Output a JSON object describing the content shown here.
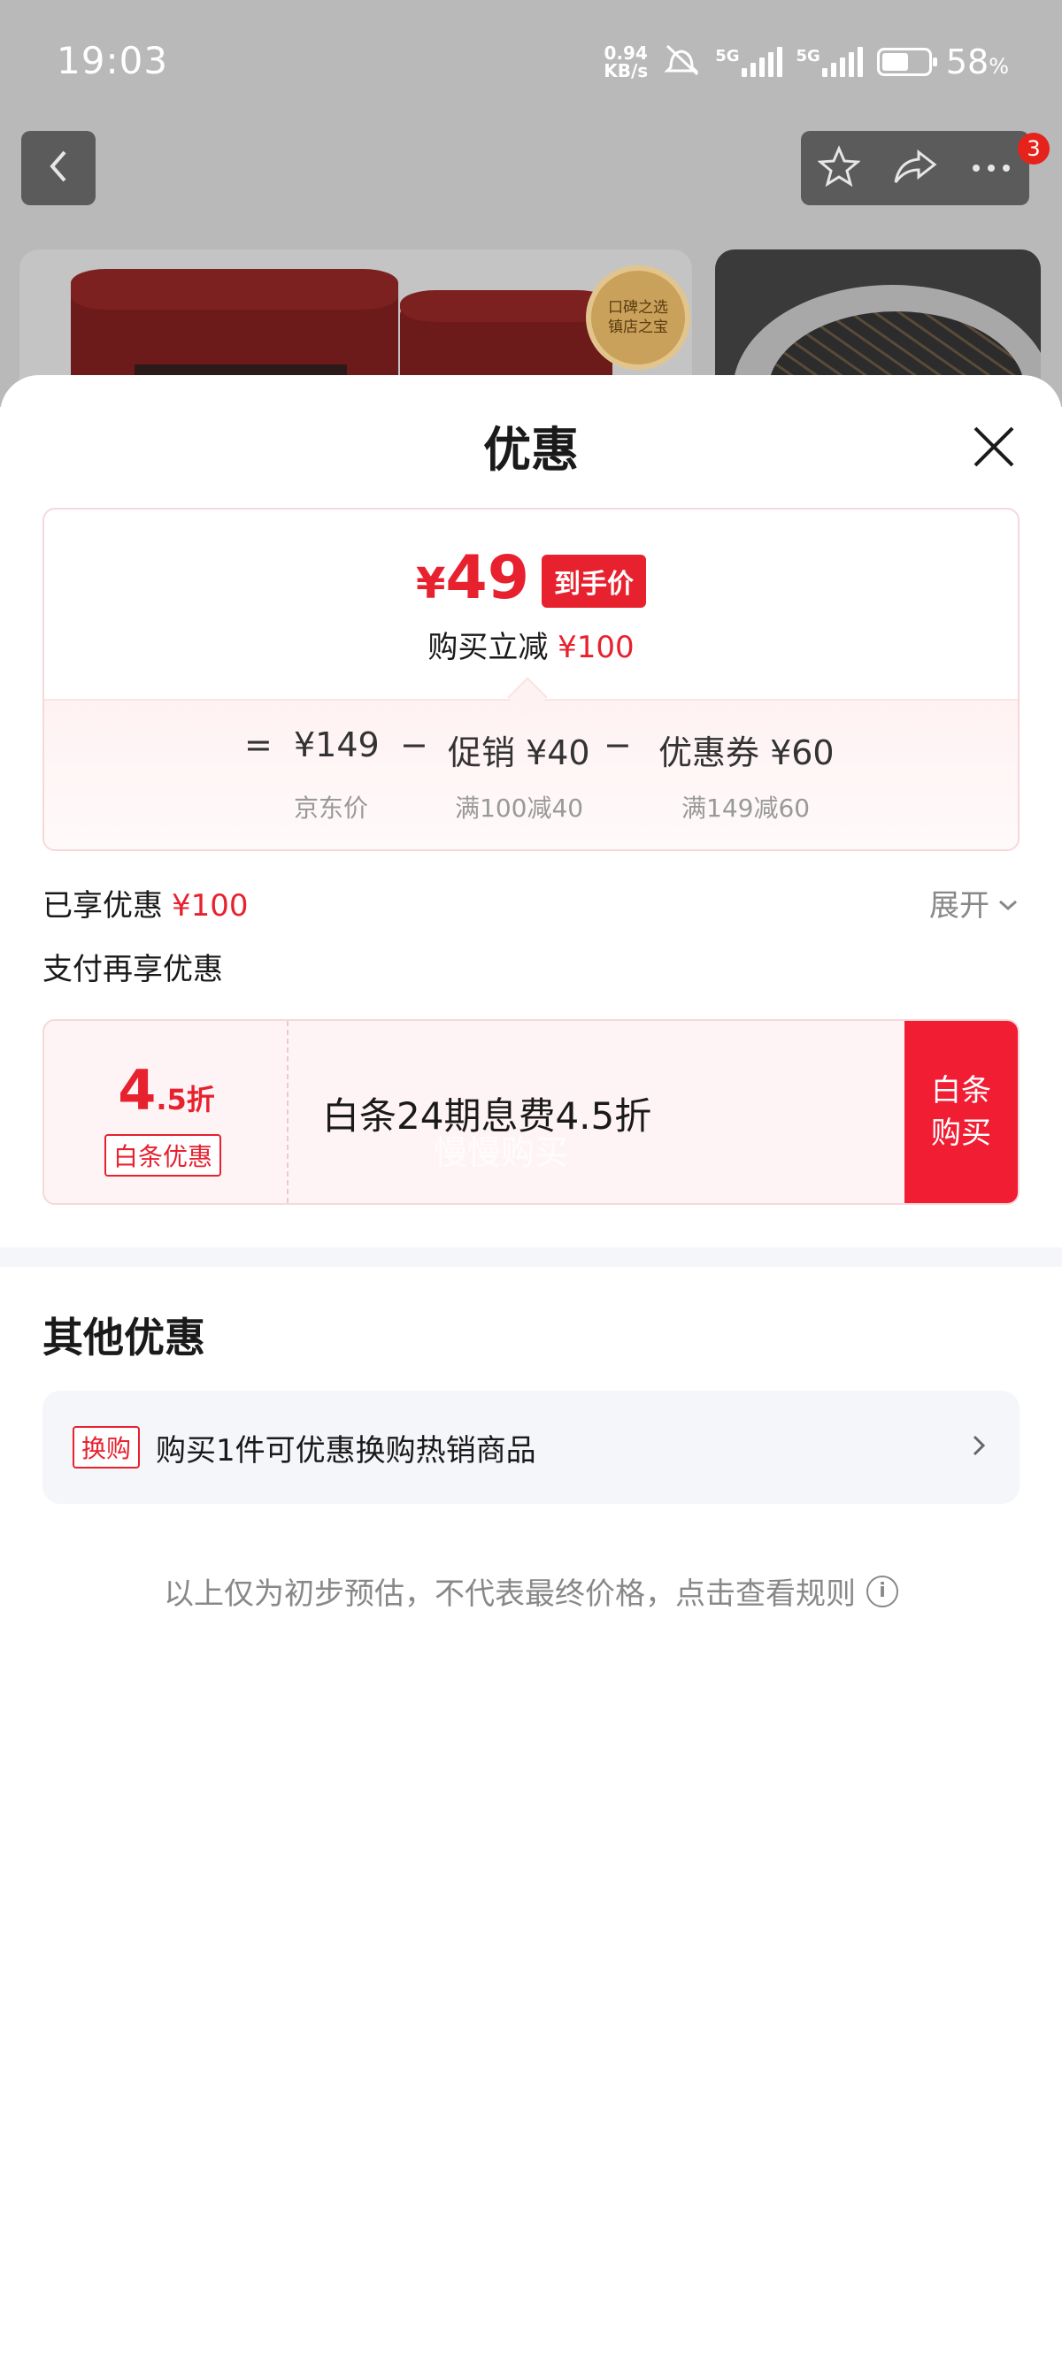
{
  "status_bar": {
    "time": "19:03",
    "net_speed_value": "0.94",
    "net_speed_unit": "KB/s",
    "signal_1_label": "5G",
    "signal_2_label": "5G",
    "battery_percent": "58",
    "battery_percent_sign": "%",
    "battery_level": 0.58
  },
  "nav": {
    "cart_badge": "3"
  },
  "product_background": {
    "award_line1": "口碑之选",
    "award_line2": "镇店之宝"
  },
  "sheet": {
    "title": "优惠",
    "price_card": {
      "yen": "¥",
      "final_price": "49",
      "final_tag": "到手价",
      "instant_reduce_label": "购买立减",
      "instant_reduce_amount": "¥100",
      "equals": "=",
      "minus": "−",
      "jd_price": "¥149",
      "jd_price_label": "京东价",
      "promo": "促销 ¥40",
      "promo_label": "满100减40",
      "coupon": "优惠券 ¥60",
      "coupon_label": "满149减60"
    },
    "enjoyed": {
      "label": "已享优惠",
      "amount": "¥100",
      "expand_label": "展开"
    },
    "pay": {
      "title": "支付再享优惠",
      "baitiao": {
        "discount_int": "4",
        "discount_dec": ".5折",
        "tag": "白条优惠",
        "description": "白条24期息费4.5折",
        "watermark": "慢慢购买",
        "button_line1": "白条",
        "button_line2": "购买"
      }
    },
    "other": {
      "title": "其他优惠",
      "swap_tag": "换购",
      "swap_text": "购买1件可优惠换购热销商品"
    },
    "disclaimer": "以上仅为初步预估，不代表最终价格，点击查看规则"
  },
  "colors": {
    "accent_red": "#e8212f",
    "button_red": "#f01d33",
    "muted_gray": "#888888"
  },
  "icons": [
    "back-arrow-icon",
    "star-icon",
    "share-icon",
    "more-icon",
    "close-icon",
    "chevron-down-icon",
    "chevron-right-icon",
    "info-icon",
    "mute-icon"
  ]
}
